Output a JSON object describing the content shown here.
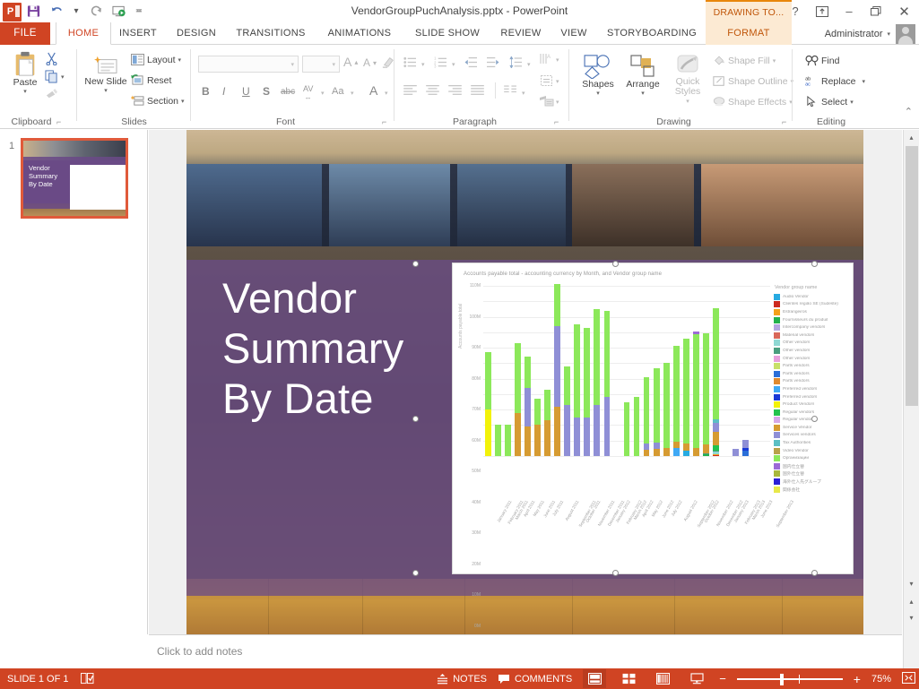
{
  "window": {
    "title": "VendorGroupPuchAnalysis.pptx - PowerPoint",
    "qat": {
      "logo": "powerpoint-logo",
      "save": "save-icon",
      "undo": "undo-icon",
      "redo": "redo-icon",
      "start_slideshow": "start-slideshow-icon",
      "customize": "customize-qat-icon"
    },
    "controls": {
      "help": "?",
      "ribbon_display": "ribbon-display-options-icon",
      "minimize": "–",
      "restore": "❐",
      "close": "✕"
    },
    "contextual_banner": "DRAWING TO..."
  },
  "tabs": [
    {
      "label": "FILE",
      "state": "file"
    },
    {
      "label": "HOME",
      "state": "active"
    },
    {
      "label": "INSERT",
      "state": "normal"
    },
    {
      "label": "DESIGN",
      "state": "normal"
    },
    {
      "label": "TRANSITIONS",
      "state": "normal"
    },
    {
      "label": "ANIMATIONS",
      "state": "normal"
    },
    {
      "label": "SLIDE SHOW",
      "state": "normal"
    },
    {
      "label": "REVIEW",
      "state": "normal"
    },
    {
      "label": "VIEW",
      "state": "normal"
    },
    {
      "label": "STORYBOARDING",
      "state": "normal"
    },
    {
      "label": "FORMAT",
      "state": "contextual"
    }
  ],
  "account": {
    "name": "Administrator",
    "avatar": "user-avatar"
  },
  "ribbon": {
    "clipboard": {
      "group_label": "Clipboard",
      "paste": "Paste",
      "cut": "cut-icon",
      "copy": "copy-icon",
      "format_painter": "format-painter-icon",
      "dialog_launcher": "clipboard-dialog-launcher"
    },
    "slides": {
      "group_label": "Slides",
      "new_slide": "New Slide",
      "layout": "Layout",
      "reset": "Reset",
      "section": "Section"
    },
    "font": {
      "group_label": "Font",
      "font_name": "",
      "font_size": "",
      "grow_font": "A",
      "shrink_font": "A",
      "clear_formatting": "clear-formatting-icon",
      "bold": "B",
      "italic": "I",
      "underline": "U",
      "shadow": "S",
      "strikethrough": "abc",
      "character_spacing": "AV",
      "change_case": "Aa",
      "font_color": "A",
      "dialog_launcher": "font-dialog-launcher"
    },
    "paragraph": {
      "group_label": "Paragraph",
      "bullets": "bullets-icon",
      "numbering": "numbering-icon",
      "decrease_indent": "decrease-indent-icon",
      "increase_indent": "increase-indent-icon",
      "line_spacing": "line-spacing-icon",
      "text_direction": "text-direction-icon",
      "align_text": "align-text-icon",
      "convert_smartart": "convert-to-smartart-icon",
      "align_left": "align-left-icon",
      "align_center": "align-center-icon",
      "align_right": "align-right-icon",
      "justify": "justify-icon",
      "columns": "columns-icon",
      "dialog_launcher": "paragraph-dialog-launcher"
    },
    "drawing": {
      "group_label": "Drawing",
      "shapes": "Shapes",
      "arrange": "Arrange",
      "quick_styles": "Quick Styles",
      "shape_fill": "Shape Fill",
      "shape_outline": "Shape Outline",
      "shape_effects": "Shape Effects",
      "dialog_launcher": "drawing-dialog-launcher"
    },
    "editing": {
      "group_label": "Editing",
      "find": "Find",
      "replace": "Replace",
      "select": "Select"
    },
    "collapse_ribbon": "collapse-ribbon-icon"
  },
  "slide_panel": {
    "slide_number": "1",
    "thumbnail_title": "Vendor\nSummary\nBy Date"
  },
  "slide": {
    "title_lines": [
      "Vendor",
      "Summary",
      "By Date"
    ]
  },
  "notes": {
    "placeholder": "Click to add notes"
  },
  "status": {
    "slide_count": "SLIDE 1 OF 1",
    "language_icon": "proofing-icon",
    "notes_label": "NOTES",
    "comments_label": "COMMENTS",
    "view_normal": "normal-view-icon",
    "view_sorter": "slide-sorter-icon",
    "view_reading": "reading-view-icon",
    "view_slideshow": "slideshow-view-icon",
    "zoom_out": "−",
    "zoom_in": "+",
    "zoom_level": "75%",
    "fit_slide": "fit-slide-to-window-icon"
  },
  "chart_data": {
    "type": "bar",
    "stacked": true,
    "title": "Accounts payable total - accounting currency by Month, and Vendor group name",
    "xlabel": "",
    "ylabel": "Accounts payable total",
    "ylim": [
      0,
      110000000
    ],
    "ytick_labels": [
      "0M",
      "10M",
      "20M",
      "30M",
      "40M",
      "50M",
      "60M",
      "70M",
      "80M",
      "90M",
      "100M",
      "110M"
    ],
    "ytick_values": [
      0,
      10,
      20,
      30,
      40,
      50,
      60,
      70,
      80,
      90,
      100,
      110
    ],
    "grid": true,
    "legend_position": "right",
    "legend_title": "Vendor group name",
    "categories": [
      "January 2011",
      "February 2011",
      "March 2011",
      "April 2011",
      "May 2011",
      "June 2011",
      "July 2011",
      "August 2011",
      "September 2011",
      "October 2011",
      "November 2011",
      "December 2011",
      "January 2012",
      "February 2012",
      "March 2012",
      "April 2012",
      "May 2012",
      "June 2012",
      "July 2012",
      "August 2012",
      "September 2012",
      "October 2012",
      "November 2012",
      "December 2012",
      "January 2013",
      "February 2013",
      "March 2013",
      "June 2013",
      "September 2013"
    ],
    "series": [
      {
        "name": "Audio Vendor",
        "color": "#27aae1",
        "values": [
          0,
          0,
          0,
          0,
          0,
          0,
          0,
          0,
          0,
          0,
          0,
          0,
          0,
          0,
          0,
          0,
          0,
          0,
          0,
          0,
          3.5,
          0,
          0,
          0,
          0,
          0,
          0,
          0,
          0
        ]
      },
      {
        "name": "Clientes região SE (Sudeste)",
        "color": "#cc2a20",
        "values": [
          0,
          0,
          0,
          0,
          0,
          0,
          0,
          0,
          0,
          0,
          0,
          0,
          0,
          0,
          0,
          0,
          0,
          0,
          0,
          0,
          0,
          0,
          0,
          0.6,
          0,
          0,
          0,
          0,
          0
        ]
      },
      {
        "name": "Estrangeiros",
        "color": "#f5a11b",
        "values": [
          0,
          0,
          0,
          0,
          0,
          0,
          0,
          0,
          0,
          0,
          0,
          0,
          0,
          0,
          0,
          0,
          0,
          0,
          0,
          0,
          0,
          0,
          0,
          0.5,
          0,
          0,
          0,
          0,
          0
        ]
      },
      {
        "name": "Fournisseurs du produit",
        "color": "#23b14d",
        "values": [
          0,
          0,
          0,
          0,
          0,
          0,
          0,
          0,
          0,
          0,
          0,
          0,
          0,
          0,
          0,
          0,
          0,
          0,
          0,
          0,
          0,
          0,
          1.2,
          0,
          0,
          0,
          0,
          0,
          0
        ]
      },
      {
        "name": "Intercompany vendors",
        "color": "#b3a6e0",
        "values": [
          0,
          0,
          0,
          0,
          0,
          0,
          0,
          0,
          0,
          0,
          0,
          0,
          0,
          0,
          0,
          0,
          0,
          0,
          0,
          0,
          0,
          0,
          0,
          0,
          0,
          0,
          0,
          0,
          0
        ]
      },
      {
        "name": "Material vendors",
        "color": "#d9685a",
        "values": [
          0,
          0,
          0,
          0,
          0,
          0,
          0,
          0,
          0,
          0,
          0,
          0,
          0,
          0,
          0,
          0,
          0,
          0,
          0,
          0,
          0,
          0,
          0,
          0,
          0,
          0,
          0,
          0,
          0
        ]
      },
      {
        "name": "Other vendors",
        "color": "#8fd8d3",
        "values": [
          0,
          0,
          0,
          0,
          0,
          0,
          0,
          0,
          0,
          0,
          0,
          0,
          0,
          0,
          0,
          0,
          0,
          0,
          0,
          0,
          0,
          0,
          0,
          1.6,
          0,
          0,
          0,
          0,
          0
        ]
      },
      {
        "name": "Other vendors",
        "color": "#4a9e7f",
        "values": [
          0,
          0,
          0,
          0,
          0,
          0,
          0,
          0,
          0,
          0,
          0,
          0,
          0,
          0,
          0,
          0,
          0,
          0,
          0,
          0,
          0,
          0,
          0.8,
          1.0,
          0,
          0,
          0,
          0,
          0
        ]
      },
      {
        "name": "Other vendors",
        "color": "#e8a0dd",
        "values": [
          0,
          0,
          0,
          0,
          0,
          0,
          0,
          0,
          0,
          0,
          0,
          0,
          0,
          0,
          0,
          0,
          0,
          0,
          0,
          0,
          0,
          0,
          0,
          0,
          0,
          0,
          0,
          0,
          0
        ]
      },
      {
        "name": "Parts vendors",
        "color": "#c8e06a",
        "values": [
          0,
          0,
          0,
          0,
          0,
          0,
          0,
          0,
          0,
          0,
          0,
          0,
          0,
          0,
          0,
          0,
          0,
          0,
          0,
          0,
          0,
          0,
          0,
          0,
          0,
          0,
          0,
          0,
          0
        ]
      },
      {
        "name": "Parts vendors",
        "color": "#2b6fd8",
        "values": [
          0,
          0,
          0,
          0,
          0,
          0,
          0,
          0,
          0,
          0,
          0,
          0,
          0,
          0,
          0,
          0,
          0,
          0,
          0,
          0,
          0,
          0,
          0,
          0,
          0,
          0,
          3.2,
          0,
          0
        ]
      },
      {
        "name": "Parts vendors",
        "color": "#e08a2e",
        "values": [
          0,
          0,
          0,
          0,
          0,
          0,
          0,
          0,
          0,
          0,
          0,
          0,
          0,
          0,
          0,
          0,
          0,
          0,
          0,
          0,
          0,
          0,
          0,
          0,
          0,
          0,
          0,
          0,
          0
        ]
      },
      {
        "name": "Preferred vendors",
        "color": "#3fa9f5",
        "values": [
          0,
          0,
          0,
          0,
          0,
          0,
          0,
          0,
          0,
          0,
          0,
          0,
          0,
          0,
          0,
          0,
          0,
          0,
          0,
          5.0,
          0,
          0,
          0,
          0,
          0,
          0,
          0,
          0,
          0
        ]
      },
      {
        "name": "Preferred vendors",
        "color": "#1939d6",
        "values": [
          0,
          0,
          0,
          0,
          0,
          0,
          0,
          0,
          0,
          0,
          0,
          0,
          0,
          0,
          0,
          0,
          0,
          0,
          0,
          0,
          0,
          0,
          0,
          0,
          0,
          0,
          2.0,
          0,
          0
        ]
      },
      {
        "name": "Product Vendors",
        "color": "#f2f20a",
        "values": [
          30,
          0,
          0,
          0,
          0,
          0,
          0,
          0,
          0,
          0,
          0,
          0,
          0,
          0,
          0,
          0,
          0,
          0,
          0,
          0,
          0,
          0,
          0,
          0,
          0,
          0,
          0,
          0,
          0
        ]
      },
      {
        "name": "Regular vendors",
        "color": "#23c24d",
        "values": [
          0,
          0,
          0,
          0,
          0,
          0,
          0,
          0,
          0,
          0,
          0,
          0,
          0,
          0,
          0,
          0,
          0,
          0,
          0,
          0,
          0,
          0,
          0,
          3.0,
          0,
          0,
          0,
          0,
          0
        ]
      },
      {
        "name": "Regular vendors",
        "color": "#d6a8e8",
        "values": [
          0,
          0,
          0,
          0,
          0,
          0,
          0,
          0,
          0,
          0,
          0,
          0,
          0,
          0,
          0,
          0,
          0,
          0,
          0,
          0,
          0,
          0,
          0,
          0,
          0,
          0,
          0,
          0,
          0
        ]
      },
      {
        "name": "Service Vendor",
        "color": "#d69b32",
        "values": [
          0,
          0,
          0,
          28,
          19,
          20,
          23,
          32,
          0,
          0,
          0,
          0,
          0,
          0,
          0,
          0,
          4.0,
          4.5,
          5.0,
          4.5,
          4.5,
          5.0,
          5.5,
          9.0,
          0,
          0,
          0,
          0,
          0
        ]
      },
      {
        "name": "Services vendors",
        "color": "#8f8fd6",
        "values": [
          0,
          0,
          0,
          0,
          25,
          0,
          0,
          52,
          33,
          25,
          25,
          33,
          38,
          0,
          0,
          0,
          4.0,
          4.0,
          0,
          0,
          0,
          0,
          0,
          5.5,
          0,
          4.5,
          5.0,
          0,
          0
        ]
      },
      {
        "name": "Tax Authorities",
        "color": "#5bbfc4",
        "values": [
          0,
          0,
          0,
          0,
          0,
          0,
          0,
          0,
          0,
          0,
          0,
          0,
          0,
          0,
          0,
          0,
          0,
          0,
          0,
          0,
          0,
          0,
          0,
          2.5,
          0,
          0,
          0,
          0,
          0
        ]
      },
      {
        "name": "Video Vendor",
        "color": "#b8a14a",
        "values": [
          0,
          0,
          0,
          0,
          0,
          0,
          0,
          0,
          0,
          0,
          0,
          0,
          0,
          0,
          0,
          0,
          0,
          0,
          0,
          0,
          0,
          0,
          0,
          0,
          0,
          0,
          0,
          0,
          0
        ]
      },
      {
        "name": "Организации",
        "color": "#8ce85a",
        "values": [
          37,
          20,
          20,
          45,
          20,
          17,
          20,
          27,
          25,
          60,
          58,
          62,
          56,
          0,
          35,
          38,
          43,
          48,
          55,
          62,
          68,
          74,
          72,
          72,
          0,
          0,
          0,
          0,
          0
        ]
      },
      {
        "name": "国内仕立替",
        "color": "#9b6ad6",
        "values": [
          0,
          0,
          0,
          0,
          0,
          0,
          0,
          0,
          0,
          0,
          0,
          0,
          0,
          0,
          0,
          0,
          0,
          0,
          0,
          0,
          0,
          1.5,
          0,
          0,
          0,
          0,
          0,
          0,
          0
        ]
      },
      {
        "name": "国外仕立替",
        "color": "#a8b83c",
        "values": [
          0,
          0,
          0,
          0,
          0,
          0,
          0,
          0,
          0,
          0,
          0,
          0,
          0,
          0,
          0,
          0,
          0,
          0,
          0,
          0,
          0,
          0,
          0,
          0,
          0,
          0,
          0,
          0,
          0
        ]
      },
      {
        "name": "海外仕入先グループ",
        "color": "#2b1fd6",
        "values": [
          0,
          0,
          0,
          0,
          0,
          0,
          0,
          0,
          0,
          0,
          0,
          0,
          0,
          0,
          0,
          0,
          0,
          0,
          0,
          0,
          0,
          0,
          0,
          0,
          0,
          0,
          0,
          0,
          0
        ]
      },
      {
        "name": "関係会社",
        "color": "#e8e84a",
        "values": [
          0,
          0,
          0,
          0,
          0,
          0,
          0,
          0,
          0,
          0,
          0,
          0,
          0,
          0,
          0,
          0,
          0,
          0,
          0,
          0,
          0,
          0,
          0,
          0,
          0,
          0,
          0,
          0,
          0
        ]
      }
    ],
    "totals": [
      67,
      20,
      20,
      73,
      64,
      57,
      63,
      84,
      112,
      85,
      83,
      95,
      94,
      0,
      35,
      38,
      51,
      56.5,
      60,
      71.5,
      76,
      80.5,
      79.5,
      95.7,
      0,
      4.5,
      10.2,
      0,
      0
    ]
  }
}
